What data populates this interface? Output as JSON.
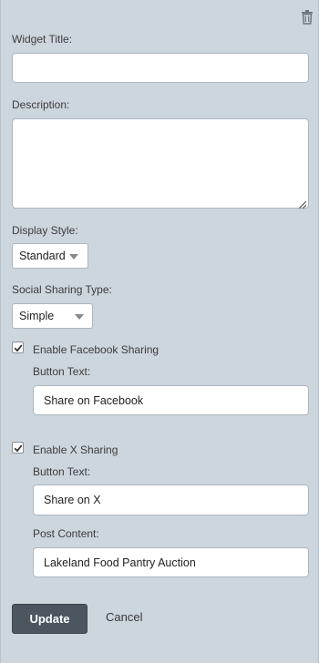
{
  "form": {
    "widget_title_label": "Widget Title:",
    "widget_title_value": "",
    "description_label": "Description:",
    "description_value": "",
    "display_style_label": "Display Style:",
    "display_style_value": "Standard",
    "social_sharing_type_label": "Social Sharing Type:",
    "social_sharing_type_value": "Simple",
    "facebook": {
      "enable_label": "Enable Facebook Sharing",
      "checked": true,
      "button_text_label": "Button Text:",
      "button_text_value": "Share on Facebook"
    },
    "x": {
      "enable_label": "Enable X Sharing",
      "checked": true,
      "button_text_label": "Button Text:",
      "button_text_value": "Share on X",
      "post_content_label": "Post Content:",
      "post_content_value": "Lakeland Food Pantry Auction"
    }
  },
  "actions": {
    "update_label": "Update",
    "cancel_label": "Cancel"
  },
  "icons": {
    "delete": "trash-icon",
    "dropdown": "chevron-down-icon",
    "checkbox": "checkmark-icon",
    "resize": "resize-grip-icon"
  },
  "colors": {
    "panel_background": "#cdd5dd",
    "primary_button": "#4b5660"
  }
}
